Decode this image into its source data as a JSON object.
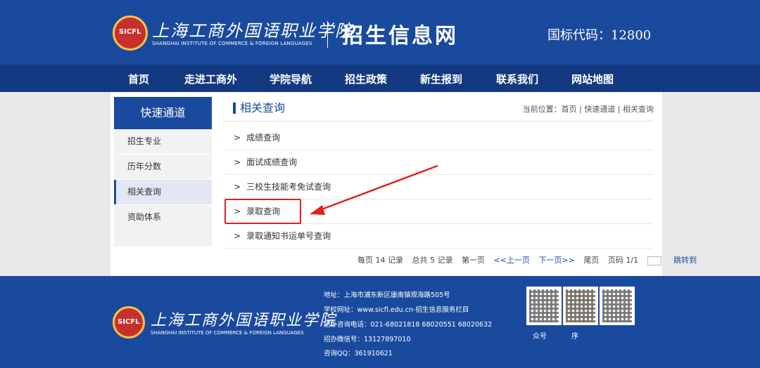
{
  "header": {
    "school_cn": "上海工商外国语职业学院",
    "school_en": "SHANGHAI INSTITUTE OF COMMERCE & FOREIGN LANGUAGES",
    "site_name": "招生信息网",
    "code": "国标代码：12800"
  },
  "nav": {
    "items": [
      "首页",
      "走进工商外",
      "学院导航",
      "招生政策",
      "新生报到",
      "联系我们",
      "网站地图"
    ]
  },
  "sidebar": {
    "title": "快速通道",
    "items": [
      "招生专业",
      "历年分数",
      "相关查询",
      "资助体系"
    ],
    "active": "相关查询"
  },
  "main": {
    "title": "相关查询",
    "breadcrumb": "当前位置：首页 | 快速通道 | 相关查询",
    "arrow": ">",
    "rows": [
      "成绩查询",
      "面试成绩查询",
      "三校生技能考免试查询",
      "录取查询",
      "录取通知书运单号查询"
    ]
  },
  "pager": {
    "per_page": "每页 14 记录",
    "total": "总共 5 记录",
    "first": "第一页",
    "prev": "<<上一页",
    "next": "下一页>>",
    "last": "尾页",
    "page": "页码 1/1",
    "jump": "跳转到"
  },
  "footer": {
    "school_cn": "上海工商外国语职业学院",
    "school_en": "SHANGHAI INSTITUTE OF COMMERCE & FOREIGN LANGUAGES",
    "address": "地址：上海市浦东新区康南镇观海路505号",
    "website": "学校网址：www.sicfl.edu.cn-招生信息服务栏目",
    "phone": "招办咨询电话：021-68021818 68020551 68020632",
    "wechat": "招办微信号：13127897010",
    "qq": "咨询QQ：361910621",
    "qr_labels": [
      "众号",
      "序"
    ]
  },
  "colors": {
    "brand_blue": "#1a4a9e",
    "nav_blue": "#133a80",
    "highlight_red": "#e02020"
  }
}
